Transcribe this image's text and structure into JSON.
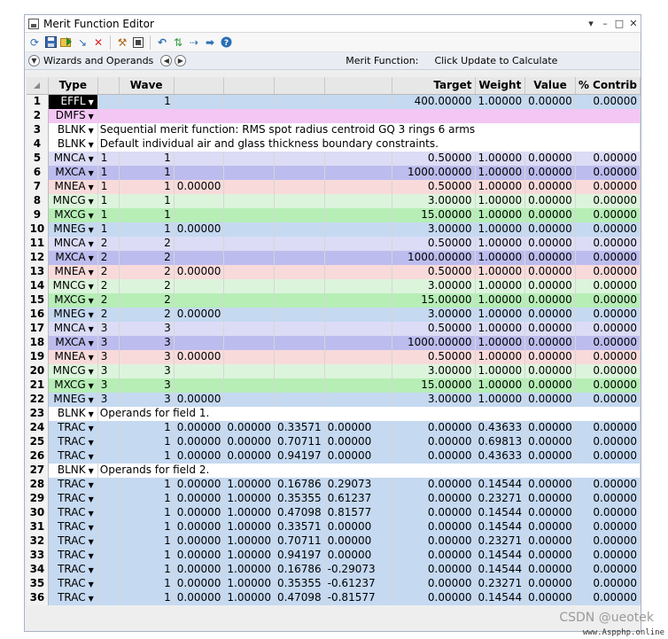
{
  "window": {
    "title": "Merit Function Editor",
    "controls": [
      "▾",
      "–",
      "□",
      "✕"
    ]
  },
  "toolbar": {
    "icons": [
      "refresh-icon",
      "save-icon",
      "load-icon",
      "insert-icon",
      "delete-icon",
      "wizard-icon",
      "options-icon",
      "undo-icon",
      "redo-icon",
      "swap-icon",
      "next-icon",
      "help-icon"
    ]
  },
  "wizbar": {
    "label": "Wizards and Operands",
    "mf_label": "Merit Function:",
    "mf_value": "Click Update to Calculate"
  },
  "columns": [
    "Type",
    "Wave",
    "Target",
    "Weight",
    "Value",
    "% Contrib"
  ],
  "row_colors": {
    "EFFL": "#c5d9f1",
    "DMFS": "#f3c6f3",
    "BLNK": "#ffffff",
    "MNCA": "#dcdcf6",
    "MXCA": "#bcbcee",
    "MNEA": "#f8dada",
    "MNCG": "#dcf4dc",
    "MXCG": "#b6eeb6",
    "MNEG": "#c5d9f1",
    "TRAC": "#c5d9f1"
  },
  "rows": [
    {
      "n": "1",
      "type": "EFFL",
      "c1": "",
      "wave": "1",
      "c3": "",
      "c4": "",
      "c5": "",
      "c6": "",
      "target": "400.00000",
      "weight": "1.00000",
      "value": "0.00000",
      "contrib": "0.00000"
    },
    {
      "n": "2",
      "type": "DMFS",
      "comment": ""
    },
    {
      "n": "3",
      "type": "BLNK",
      "comment": "Sequential merit function: RMS spot radius centroid GQ 3 rings 6 arms"
    },
    {
      "n": "4",
      "type": "BLNK",
      "comment": "Default individual air and glass thickness boundary constraints."
    },
    {
      "n": "5",
      "type": "MNCA",
      "c1": "1",
      "wave": "1",
      "c3": "",
      "c4": "",
      "c5": "",
      "c6": "",
      "target": "0.50000",
      "weight": "1.00000",
      "value": "0.00000",
      "contrib": "0.00000"
    },
    {
      "n": "6",
      "type": "MXCA",
      "c1": "1",
      "wave": "1",
      "c3": "",
      "c4": "",
      "c5": "",
      "c6": "",
      "target": "1000.00000",
      "weight": "1.00000",
      "value": "0.00000",
      "contrib": "0.00000"
    },
    {
      "n": "7",
      "type": "MNEA",
      "c1": "1",
      "wave": "1",
      "c3": "0.00000",
      "c4": "",
      "c5": "",
      "c6": "",
      "target": "0.50000",
      "weight": "1.00000",
      "value": "0.00000",
      "contrib": "0.00000"
    },
    {
      "n": "8",
      "type": "MNCG",
      "c1": "1",
      "wave": "1",
      "c3": "",
      "c4": "",
      "c5": "",
      "c6": "",
      "target": "3.00000",
      "weight": "1.00000",
      "value": "0.00000",
      "contrib": "0.00000"
    },
    {
      "n": "9",
      "type": "MXCG",
      "c1": "1",
      "wave": "1",
      "c3": "",
      "c4": "",
      "c5": "",
      "c6": "",
      "target": "15.00000",
      "weight": "1.00000",
      "value": "0.00000",
      "contrib": "0.00000"
    },
    {
      "n": "10",
      "type": "MNEG",
      "c1": "1",
      "wave": "1",
      "c3": "0.00000",
      "c4": "",
      "c5": "",
      "c6": "",
      "target": "3.00000",
      "weight": "1.00000",
      "value": "0.00000",
      "contrib": "0.00000"
    },
    {
      "n": "11",
      "type": "MNCA",
      "c1": "2",
      "wave": "2",
      "c3": "",
      "c4": "",
      "c5": "",
      "c6": "",
      "target": "0.50000",
      "weight": "1.00000",
      "value": "0.00000",
      "contrib": "0.00000"
    },
    {
      "n": "12",
      "type": "MXCA",
      "c1": "2",
      "wave": "2",
      "c3": "",
      "c4": "",
      "c5": "",
      "c6": "",
      "target": "1000.00000",
      "weight": "1.00000",
      "value": "0.00000",
      "contrib": "0.00000"
    },
    {
      "n": "13",
      "type": "MNEA",
      "c1": "2",
      "wave": "2",
      "c3": "0.00000",
      "c4": "",
      "c5": "",
      "c6": "",
      "target": "0.50000",
      "weight": "1.00000",
      "value": "0.00000",
      "contrib": "0.00000"
    },
    {
      "n": "14",
      "type": "MNCG",
      "c1": "2",
      "wave": "2",
      "c3": "",
      "c4": "",
      "c5": "",
      "c6": "",
      "target": "3.00000",
      "weight": "1.00000",
      "value": "0.00000",
      "contrib": "0.00000"
    },
    {
      "n": "15",
      "type": "MXCG",
      "c1": "2",
      "wave": "2",
      "c3": "",
      "c4": "",
      "c5": "",
      "c6": "",
      "target": "15.00000",
      "weight": "1.00000",
      "value": "0.00000",
      "contrib": "0.00000"
    },
    {
      "n": "16",
      "type": "MNEG",
      "c1": "2",
      "wave": "2",
      "c3": "0.00000",
      "c4": "",
      "c5": "",
      "c6": "",
      "target": "3.00000",
      "weight": "1.00000",
      "value": "0.00000",
      "contrib": "0.00000"
    },
    {
      "n": "17",
      "type": "MNCA",
      "c1": "3",
      "wave": "3",
      "c3": "",
      "c4": "",
      "c5": "",
      "c6": "",
      "target": "0.50000",
      "weight": "1.00000",
      "value": "0.00000",
      "contrib": "0.00000"
    },
    {
      "n": "18",
      "type": "MXCA",
      "c1": "3",
      "wave": "3",
      "c3": "",
      "c4": "",
      "c5": "",
      "c6": "",
      "target": "1000.00000",
      "weight": "1.00000",
      "value": "0.00000",
      "contrib": "0.00000"
    },
    {
      "n": "19",
      "type": "MNEA",
      "c1": "3",
      "wave": "3",
      "c3": "0.00000",
      "c4": "",
      "c5": "",
      "c6": "",
      "target": "0.50000",
      "weight": "1.00000",
      "value": "0.00000",
      "contrib": "0.00000"
    },
    {
      "n": "20",
      "type": "MNCG",
      "c1": "3",
      "wave": "3",
      "c3": "",
      "c4": "",
      "c5": "",
      "c6": "",
      "target": "3.00000",
      "weight": "1.00000",
      "value": "0.00000",
      "contrib": "0.00000"
    },
    {
      "n": "21",
      "type": "MXCG",
      "c1": "3",
      "wave": "3",
      "c3": "",
      "c4": "",
      "c5": "",
      "c6": "",
      "target": "15.00000",
      "weight": "1.00000",
      "value": "0.00000",
      "contrib": "0.00000"
    },
    {
      "n": "22",
      "type": "MNEG",
      "c1": "3",
      "wave": "3",
      "c3": "0.00000",
      "c4": "",
      "c5": "",
      "c6": "",
      "target": "3.00000",
      "weight": "1.00000",
      "value": "0.00000",
      "contrib": "0.00000"
    },
    {
      "n": "23",
      "type": "BLNK",
      "comment": "Operands for field 1."
    },
    {
      "n": "24",
      "type": "TRAC",
      "c1": "",
      "wave": "1",
      "c3": "0.00000",
      "c4": "0.00000",
      "c5": "0.33571",
      "c6": "0.00000",
      "target": "0.00000",
      "weight": "0.43633",
      "value": "0.00000",
      "contrib": "0.00000"
    },
    {
      "n": "25",
      "type": "TRAC",
      "c1": "",
      "wave": "1",
      "c3": "0.00000",
      "c4": "0.00000",
      "c5": "0.70711",
      "c6": "0.00000",
      "target": "0.00000",
      "weight": "0.69813",
      "value": "0.00000",
      "contrib": "0.00000"
    },
    {
      "n": "26",
      "type": "TRAC",
      "c1": "",
      "wave": "1",
      "c3": "0.00000",
      "c4": "0.00000",
      "c5": "0.94197",
      "c6": "0.00000",
      "target": "0.00000",
      "weight": "0.43633",
      "value": "0.00000",
      "contrib": "0.00000"
    },
    {
      "n": "27",
      "type": "BLNK",
      "comment": "Operands for field 2."
    },
    {
      "n": "28",
      "type": "TRAC",
      "c1": "",
      "wave": "1",
      "c3": "0.00000",
      "c4": "1.00000",
      "c5": "0.16786",
      "c6": "0.29073",
      "target": "0.00000",
      "weight": "0.14544",
      "value": "0.00000",
      "contrib": "0.00000"
    },
    {
      "n": "29",
      "type": "TRAC",
      "c1": "",
      "wave": "1",
      "c3": "0.00000",
      "c4": "1.00000",
      "c5": "0.35355",
      "c6": "0.61237",
      "target": "0.00000",
      "weight": "0.23271",
      "value": "0.00000",
      "contrib": "0.00000"
    },
    {
      "n": "30",
      "type": "TRAC",
      "c1": "",
      "wave": "1",
      "c3": "0.00000",
      "c4": "1.00000",
      "c5": "0.47098",
      "c6": "0.81577",
      "target": "0.00000",
      "weight": "0.14544",
      "value": "0.00000",
      "contrib": "0.00000"
    },
    {
      "n": "31",
      "type": "TRAC",
      "c1": "",
      "wave": "1",
      "c3": "0.00000",
      "c4": "1.00000",
      "c5": "0.33571",
      "c6": "0.00000",
      "target": "0.00000",
      "weight": "0.14544",
      "value": "0.00000",
      "contrib": "0.00000"
    },
    {
      "n": "32",
      "type": "TRAC",
      "c1": "",
      "wave": "1",
      "c3": "0.00000",
      "c4": "1.00000",
      "c5": "0.70711",
      "c6": "0.00000",
      "target": "0.00000",
      "weight": "0.23271",
      "value": "0.00000",
      "contrib": "0.00000"
    },
    {
      "n": "33",
      "type": "TRAC",
      "c1": "",
      "wave": "1",
      "c3": "0.00000",
      "c4": "1.00000",
      "c5": "0.94197",
      "c6": "0.00000",
      "target": "0.00000",
      "weight": "0.14544",
      "value": "0.00000",
      "contrib": "0.00000"
    },
    {
      "n": "34",
      "type": "TRAC",
      "c1": "",
      "wave": "1",
      "c3": "0.00000",
      "c4": "1.00000",
      "c5": "0.16786",
      "c6": "-0.29073",
      "target": "0.00000",
      "weight": "0.14544",
      "value": "0.00000",
      "contrib": "0.00000"
    },
    {
      "n": "35",
      "type": "TRAC",
      "c1": "",
      "wave": "1",
      "c3": "0.00000",
      "c4": "1.00000",
      "c5": "0.35355",
      "c6": "-0.61237",
      "target": "0.00000",
      "weight": "0.23271",
      "value": "0.00000",
      "contrib": "0.00000"
    },
    {
      "n": "36",
      "type": "TRAC",
      "c1": "",
      "wave": "1",
      "c3": "0.00000",
      "c4": "1.00000",
      "c5": "0.47098",
      "c6": "-0.81577",
      "target": "0.00000",
      "weight": "0.14544",
      "value": "0.00000",
      "contrib": "0.00000"
    }
  ],
  "watermark": "CSDN @ueotek",
  "watermark2": "www.Aspphp.online"
}
